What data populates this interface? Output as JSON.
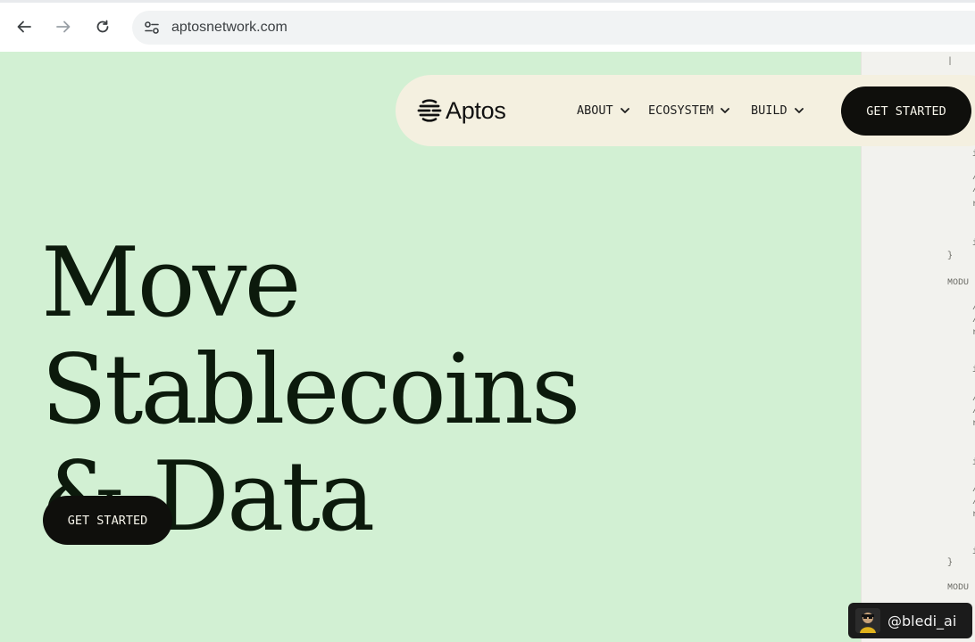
{
  "browser": {
    "url": "aptosnetwork.com"
  },
  "site": {
    "brand": "Aptos",
    "nav": {
      "items": [
        {
          "label": "ABOUT"
        },
        {
          "label": "ECOSYSTEM"
        },
        {
          "label": "BUILD"
        }
      ],
      "cta_label": "GET STARTED"
    },
    "hero": {
      "title_line1": "Move Stablecoins",
      "title_line2": "& Data",
      "cta_label": "GET STARTED"
    },
    "code_panel": {
      "lines": [
        "}",
        "MODU",
        "}",
        "MODU"
      ]
    }
  },
  "watermark": {
    "handle": "@bledi_ai"
  },
  "colors": {
    "page_bg": "#d2f0d3",
    "nav_bg": "#f4f0e0",
    "button_bg": "#0f0f0c",
    "button_text": "#f6f4ea",
    "title_text": "#0c1a0c"
  }
}
